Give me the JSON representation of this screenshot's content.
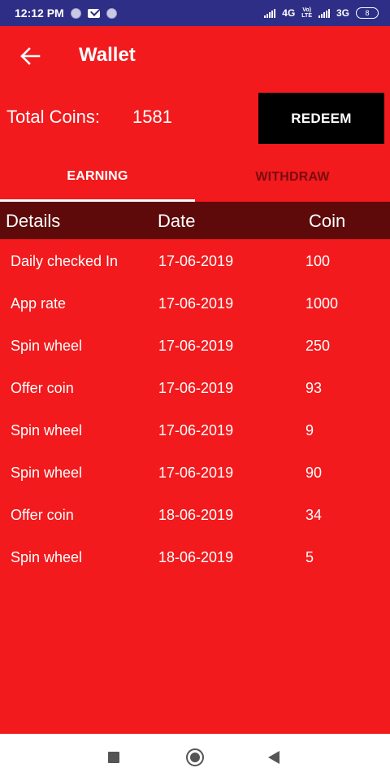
{
  "status_bar": {
    "time": "12:12 PM",
    "network_1": "4G",
    "volte_top": "Vo)",
    "volte_bottom": "LTE",
    "network_2": "3G",
    "battery": "8"
  },
  "app_bar": {
    "title": "Wallet",
    "back_icon": "arrow-left-icon"
  },
  "coins": {
    "label": "Total Coins:",
    "value": "1581",
    "redeem_label": "REDEEM"
  },
  "tabs": [
    {
      "label": "EARNING",
      "active": true
    },
    {
      "label": "WITHDRAW",
      "active": false
    }
  ],
  "table": {
    "columns": [
      "Details",
      "Date",
      "Coin"
    ],
    "rows": [
      {
        "details": "Daily checked In",
        "date": "17-06-2019",
        "coin": "100"
      },
      {
        "details": "App rate",
        "date": "17-06-2019",
        "coin": "1000"
      },
      {
        "details": "Spin wheel",
        "date": "17-06-2019",
        "coin": "250"
      },
      {
        "details": "Offer coin",
        "date": "17-06-2019",
        "coin": "93"
      },
      {
        "details": "Spin wheel",
        "date": "17-06-2019",
        "coin": "9"
      },
      {
        "details": "Spin wheel",
        "date": "17-06-2019",
        "coin": "90"
      },
      {
        "details": "Offer coin",
        "date": "18-06-2019",
        "coin": "34"
      },
      {
        "details": "Spin wheel",
        "date": "18-06-2019",
        "coin": "5"
      }
    ]
  },
  "colors": {
    "background": "#F21A1D",
    "status_bar": "#2E2E86",
    "table_header": "#5E0A0A",
    "redeem_button": "#000000",
    "inactive_tab": "#7A0C0E"
  },
  "nav_bar": {
    "icons": [
      "recents-square-icon",
      "home-circle-icon",
      "back-triangle-icon"
    ]
  }
}
